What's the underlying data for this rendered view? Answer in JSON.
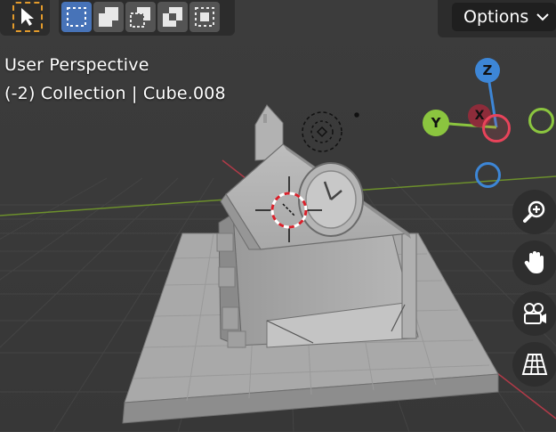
{
  "viewport": {
    "view_name": "User Perspective",
    "collection_info": "(-2) Collection | Cube.008"
  },
  "toolbar": {
    "tool_select_icon": "cursor-arrow-icon",
    "select_mode_buttons": [
      {
        "icon": "select-new-icon",
        "active": true
      },
      {
        "icon": "select-extend-icon",
        "active": false
      },
      {
        "icon": "select-subtract-icon",
        "active": false
      },
      {
        "icon": "select-difference-icon",
        "active": false
      },
      {
        "icon": "select-intersect-icon",
        "active": false
      }
    ]
  },
  "header": {
    "options_label": "Options"
  },
  "gizmo": {
    "z_label": "Z",
    "y_label": "Y",
    "x_label": "X",
    "colors": {
      "x": "#e8435a",
      "y": "#8bc53f",
      "z": "#3d86d6"
    }
  },
  "nav_buttons": [
    {
      "icon": "zoom-icon"
    },
    {
      "icon": "hand-pan-icon"
    },
    {
      "icon": "camera-icon"
    },
    {
      "icon": "grid-perspective-icon"
    }
  ]
}
